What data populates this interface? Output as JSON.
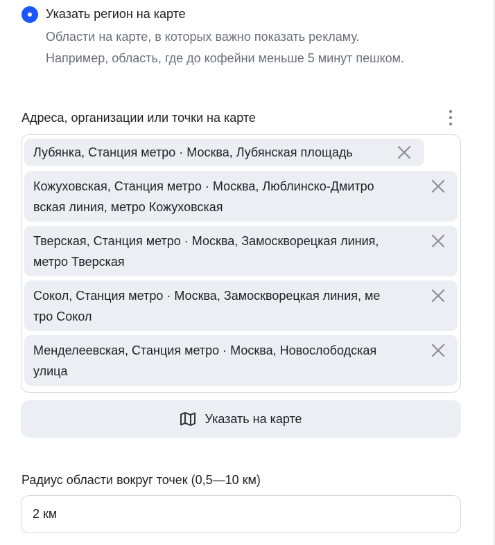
{
  "radio": {
    "label": "Указать регион на карте",
    "description_lines": [
      "Области на карте, в которых важно показать рекламу.",
      "Например, область, где до кофейни меньше 5 минут пешком."
    ],
    "selected": true,
    "accent_color": "#1b57ff"
  },
  "addresses": {
    "label": "Адреса, организации или точки на карте",
    "menu_icon": "more-vertical-icon",
    "chips": [
      {
        "lines": [
          "Лубянка, Станция метро · Москва, Лубянская площадь"
        ]
      },
      {
        "lines": [
          "Кожуховская, Станция метро · Москва, Люблинско-Дмитро",
          "вская линия, метро Кожуховская"
        ]
      },
      {
        "lines": [
          "Тверская, Станция метро · Москва, Замоскворецкая линия,",
          "метро Тверская"
        ]
      },
      {
        "lines": [
          "Сокол, Станция метро · Москва, Замоскворецкая линия, ме",
          "тро Сокол"
        ]
      },
      {
        "lines": [
          "Менделеевская, Станция метро · Москва, Новослободская",
          "улица"
        ]
      }
    ],
    "remove_icon": "close-icon"
  },
  "map_button": {
    "label": "Указать на карте",
    "icon": "map-icon"
  },
  "radius": {
    "label": "Радиус области вокруг точек (0,5—10 км)",
    "value": "2 км"
  }
}
